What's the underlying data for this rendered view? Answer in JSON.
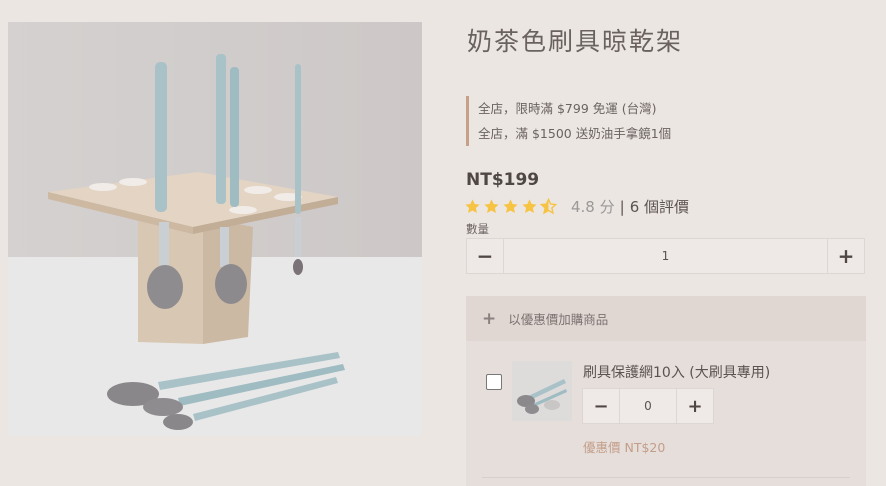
{
  "product": {
    "title": "奶茶色刷具晾乾架",
    "image_alt": "brush drying rack photo",
    "promotions": [
      "全店，限時滿 $799 免運 (台灣)",
      "全店，滿 $1500 送奶油手拿鏡1個"
    ],
    "price": "NT$199",
    "rating": {
      "stars": 4.5,
      "score_text": "4.8 分",
      "separator": "|",
      "reviews_text": "6 個評價"
    },
    "quantity": {
      "label": "數量",
      "value": "1",
      "minus": "−",
      "plus": "+"
    }
  },
  "addon": {
    "header_icon": "+",
    "header_label": "以優惠價加購商品",
    "items": [
      {
        "name": "刷具保護網10入 (大刷具專用)",
        "quantity": "0",
        "minus": "−",
        "plus": "+",
        "price": "優惠價 NT$20",
        "checked": false
      }
    ]
  },
  "colors": {
    "background": "#ece6e3",
    "star": "#f6c343",
    "promo_border": "#c8a08a",
    "addon_price": "#c39e89"
  }
}
